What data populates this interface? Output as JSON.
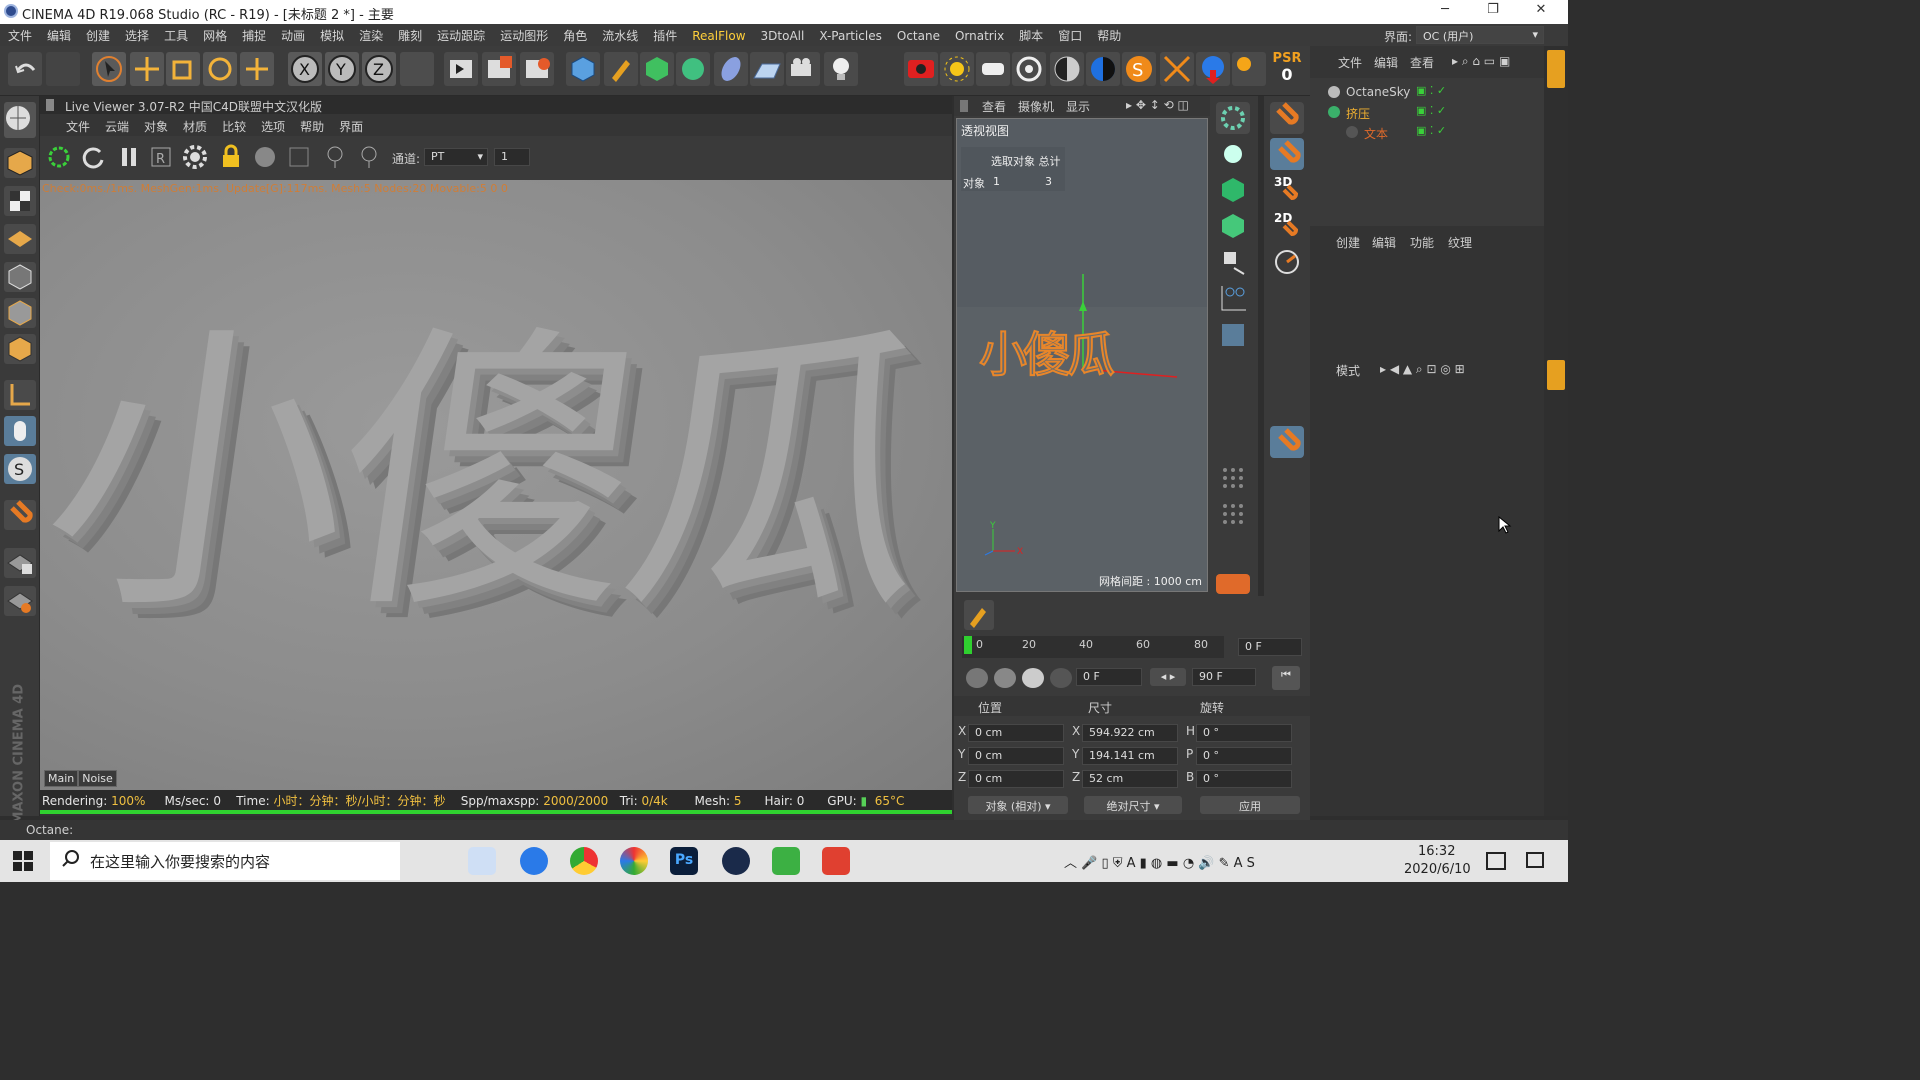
{
  "window": {
    "title": "CINEMA 4D R19.068 Studio (RC - R19) - [未标题 2 *] - 主要"
  },
  "menu": [
    "文件",
    "编辑",
    "创建",
    "选择",
    "工具",
    "网格",
    "捕捉",
    "动画",
    "模拟",
    "渲染",
    "雕刻",
    "运动跟踪",
    "运动图形",
    "角色",
    "流水线",
    "插件",
    "RealFlow",
    "3DtoAll",
    "X-Particles",
    "Octane",
    "Ornatrix",
    "脚本",
    "窗口",
    "帮助"
  ],
  "layout": {
    "label": "界面:",
    "value": "OC (用户)"
  },
  "psr": {
    "label": "PSR",
    "value": "0"
  },
  "liveviewer": {
    "title": "Live Viewer 3.07-R2 中国C4D联盟中文汉化版",
    "menu": [
      "文件",
      "云端",
      "对象",
      "材质",
      "比较",
      "选项",
      "帮助",
      "界面"
    ],
    "channel_label": "通道:",
    "channel_value": "PT",
    "channel_num": "1",
    "stats": "Check:0ms./1ms. MeshGen:1ms. Update[G]:117ms. Mesh:5 Nodes:20 Movable:5  0 0",
    "render_text": "小傻瓜",
    "tabs": [
      "Main",
      "Noise"
    ],
    "status": {
      "rendering_label": "Rendering:",
      "rendering": "100%",
      "mssec_label": "Ms/sec:",
      "mssec": "0",
      "time_label": "Time:",
      "time": "小时：分钟：秒/小时：分钟：秒",
      "spp_label": "Spp/maxspp:",
      "spp": "2000/2000",
      "tri_label": "Tri:",
      "tri": "0/4k",
      "mesh_label": "Mesh:",
      "mesh": "5",
      "hair_label": "Hair:",
      "hair": "0",
      "gpu_label": "GPU:",
      "temp": "65°C"
    },
    "progress": 1.0
  },
  "viewport": {
    "menu": [
      "查看",
      "摄像机",
      "显示"
    ],
    "name": "透视视图",
    "sel_header": "选取对象 总计",
    "sel_row_label": "对象",
    "sel_row_sel": "1",
    "sel_row_total": "3",
    "text": "小傻瓜",
    "grid": "网格间距 : 1000 cm"
  },
  "timeline": {
    "ticks": [
      "0",
      "20",
      "40",
      "60",
      "80"
    ],
    "frame": "0 F",
    "start": "0 F",
    "end": "90 F"
  },
  "coords": {
    "headers": [
      "位置",
      "尺寸",
      "旋转"
    ],
    "pos": [
      {
        "axis": "X",
        "value": "0 cm"
      },
      {
        "axis": "Y",
        "value": "0 cm"
      },
      {
        "axis": "Z",
        "value": "0 cm"
      }
    ],
    "size": [
      {
        "axis": "X",
        "value": "594.922 cm"
      },
      {
        "axis": "Y",
        "value": "194.141 cm"
      },
      {
        "axis": "Z",
        "value": "52 cm"
      }
    ],
    "rot": [
      {
        "axis": "H",
        "value": "0 °"
      },
      {
        "axis": "P",
        "value": "0 °"
      },
      {
        "axis": "B",
        "value": "0 °"
      }
    ],
    "mode1": "对象 (相对)",
    "mode2": "绝对尺寸",
    "apply": "应用"
  },
  "objects": {
    "menu": [
      "文件",
      "编辑",
      "查看"
    ],
    "items": [
      {
        "name": "OctaneSky",
        "color": "#cfcfcf"
      },
      {
        "name": "挤压",
        "color": "#f0b030"
      },
      {
        "name": "文本",
        "color": "#e06a2a"
      }
    ]
  },
  "attributes": {
    "menu": [
      "创建",
      "编辑",
      "功能",
      "纹理"
    ]
  },
  "attr2": {
    "label": "模式"
  },
  "octane_status": "Octane:",
  "taskbar": {
    "search_placeholder": "在这里输入你要搜索的内容",
    "time": "16:32",
    "date": "2020/6/10"
  },
  "maxon": "MAXON CINEMA 4D",
  "colors": {
    "accent_orange": "#e97a24",
    "progress": "#2fd02f",
    "realflow": "#ffcf3a"
  }
}
